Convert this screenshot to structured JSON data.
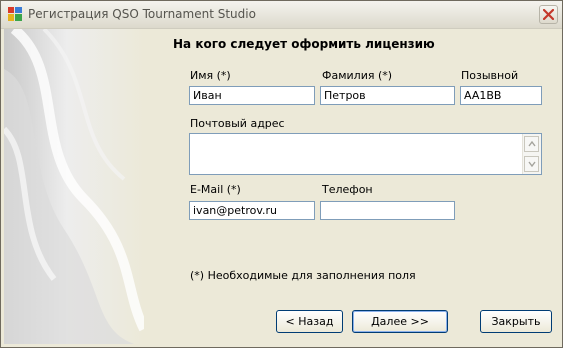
{
  "window": {
    "title": "Регистрация QSO Tournament Studio"
  },
  "form": {
    "heading": "На кого следует оформить лицензию",
    "first_name": {
      "label": "Имя (*)",
      "value": "Иван"
    },
    "last_name": {
      "label": "Фамилия (*)",
      "value": "Петров"
    },
    "callsign": {
      "label": "Позывной",
      "value": "AA1BB"
    },
    "address": {
      "label": "Почтовый адрес",
      "value": ""
    },
    "email": {
      "label": "E-Mail (*)",
      "value": "ivan@petrov.ru"
    },
    "phone": {
      "label": "Телефон",
      "value": ""
    },
    "required_note": "(*) Необходимые для заполнения поля"
  },
  "buttons": {
    "back": "< Назад",
    "next": "Далее >>",
    "close": "Закрыть"
  },
  "icons": {
    "app": "app-icon",
    "close": "close-icon",
    "scroll_up": "scroll-up-icon",
    "scroll_down": "scroll-down-icon"
  },
  "colors": {
    "dialog_background": "#ece9d8",
    "field_border": "#7f9db9",
    "button_border": "#003c74",
    "close_x": "#c4372a"
  }
}
